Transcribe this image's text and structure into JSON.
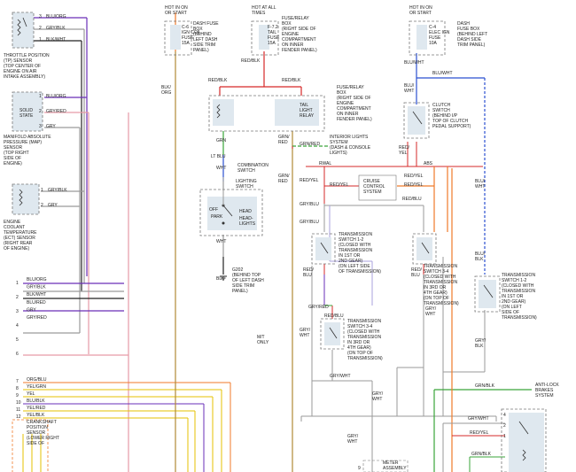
{
  "colors": {
    "purple": "#6a2fb8",
    "blue": "#2b4fd0",
    "black": "#222222",
    "pink": "#e79aa6",
    "gray": "#9a9a9a",
    "red": "#d62828",
    "orange": "#f07a2a",
    "yellow": "#e6c200",
    "green": "#3aa53a",
    "olive": "#b08a36",
    "lavender": "#a9a2dc",
    "tan": "#a88f6a",
    "box_fill": "#dfe8ef"
  },
  "left": {
    "tp_pins": [
      "3",
      "2",
      "1"
    ],
    "tp_wires": [
      "BLU/ORG",
      "GRY/BLK",
      "BLK/WHT"
    ],
    "tp_lines": [
      "THROTTLE POSITION",
      "(TP) SENSOR",
      "(TOP CENTER OF",
      "ENGINE ON AIR",
      "INTAKE ASSEMBLY)"
    ],
    "map_pins": [
      "1",
      "2",
      "3"
    ],
    "map_wires": [
      "BLU/ORG",
      "GRY/RED",
      "GRY"
    ],
    "map_box": [
      "SOLID",
      "STATE"
    ],
    "map_lines": [
      "MANIFOLD ABSOLUTE",
      "PRESSURE (MAP)",
      "SENSOR",
      "(TOP RIGHT",
      "SIDE OF",
      "ENGINE)"
    ],
    "ect_pins": [
      "1",
      "2"
    ],
    "ect_wires": [
      "GRY/BLK",
      "GRY"
    ],
    "ect_lines": [
      "ENGINE",
      "COOLANT",
      "TEMPERATURE",
      "(ECT) SENSOR",
      "(RIGHT REAR",
      "OF ENGINE)"
    ],
    "bus_labels": [
      "BLU/ORG",
      "GRY/BLK",
      "BLK/WHT",
      "BLU/RED",
      "GRY",
      "GRY/RED"
    ],
    "bus_nums": [
      "1",
      "2",
      "3",
      "4",
      "5",
      "6"
    ],
    "bus2_labels": [
      "ORG/BLU",
      "YEL/GRN",
      "YEL",
      "BLU/BLK",
      "YEL/RED",
      "YEL/BLK"
    ],
    "bus2_nums": [
      "7",
      "8",
      "9",
      "10",
      "11",
      "12"
    ],
    "ckp_lines": [
      "CRANKSHAFT",
      "POSITION",
      "SENSOR",
      "(LOWER RIGHT",
      "SIDE OF"
    ],
    "left_vertical": [
      "BLK/",
      "ORG"
    ]
  },
  "top": {
    "hot1": [
      "HOT IN ON",
      "OR START"
    ],
    "fuse_c6": [
      "C-6",
      "IGN COIL",
      "FUSE",
      "15A"
    ],
    "dash_fuse_box": [
      "DASH FUSE",
      "BOX",
      "(BEHIND",
      "LEFT DASH",
      "SIDE TRIM",
      "PANEL)"
    ],
    "hot2": [
      "HOT AT ALL",
      "TIMES"
    ],
    "fuse_f72": [
      "F-7.2",
      "TAIL",
      "FUSE",
      "15A"
    ],
    "relay_box1": [
      "FUSE/RELAY",
      "BOX",
      "(RIGHT SIDE OF",
      "ENGINE",
      "COMPARTMENT",
      "ON INNER",
      "FENDER PANEL)"
    ],
    "hot3": [
      "HOT IN ON",
      "OR START"
    ],
    "fuse_c4": [
      "C-4",
      "ELEC IGN",
      "FUSE",
      "10A"
    ],
    "dash_fuse_box2": [
      "DASH",
      "FUSE BOX",
      "(BEHIND LEFT",
      "DASH SIDE",
      "TRIM PANEL)"
    ]
  },
  "center": {
    "red_blk_1": "RED/BLK",
    "red_blk_2": "RED/BLK",
    "red_blk_3": "RED/BLK",
    "tail_relay": [
      "TAIL",
      "LIGHT",
      "RELAY"
    ],
    "relay_box2": [
      "FUSE/RELAY",
      "BOX",
      "(RIGHT SIDE OF",
      "ENGINE",
      "COMPARTMENT",
      "ON INNER",
      "FENDER PANEL)"
    ],
    "grn": "GRN",
    "lt_blu": "LT BLU",
    "wht": "WHT",
    "combo": [
      "COMBINATION",
      "SWITCH"
    ],
    "lighting": [
      "LIGHTING",
      "SWITCH"
    ],
    "off": "OFF",
    "park": "PARK",
    "head": "HEAD",
    "headlights": [
      "HEAD-",
      "LIGHTS"
    ],
    "wht2": "WHT",
    "blk": "BLK",
    "g202": [
      "G202",
      "(BEHIND TOP",
      "OF LEFT DASH",
      "SIDE TRIM",
      "PANEL)"
    ],
    "grn_red": [
      "GRN/",
      "RED"
    ],
    "grn_red2": "GRN/RED",
    "interior": [
      "INTERIOR LIGHTS",
      "SYSTEM",
      "(DASH & CONSOLE",
      "LIGHTS)"
    ],
    "grn_red3": [
      "GRN/",
      "RED"
    ],
    "mt_only": [
      "M/T",
      "ONLY"
    ]
  },
  "cruise": {
    "rwal": "RWAL",
    "abs": "ABS",
    "red_yel_l": "RED/YEL",
    "red_yel_c": "RED/YEL",
    "red_yel_r": "RED/YEL",
    "red_yel_r2": "RED/YEL",
    "cruise_box": [
      "CRUISE",
      "CONTROL",
      "SYSTEM"
    ],
    "gry_blu": "GRY/BLU",
    "gry_blu2": "GRY/BLU",
    "red_blu": "RED/BLU",
    "ts12a": [
      "TRANSMISSION",
      "SWITCH 1-2",
      "(CLOSED WITH",
      "TRANSMISSION",
      "IN 1ST OR",
      "2ND GEAR)",
      "(ON LEFT SIDE",
      "OF TRANSMISSION)"
    ],
    "red_blu_b": [
      "RED/",
      "BLU"
    ],
    "gry_red": "GRY/RED",
    "ts34a": [
      "TRANSMISSION",
      "SWITCH 3-4",
      "(CLOSED WITH",
      "TRANSMISSION",
      "IN 3RD OR",
      "4TH GEAR)",
      "(ON TOP OF",
      "TRANSMISSION)"
    ],
    "red_blu_c": "RED/BLU",
    "gry_wht_a": [
      "GRY/",
      "WHT"
    ],
    "gry_wht_b": "GRY/WHT",
    "gry_wht_c": [
      "GRY/",
      "WHT"
    ],
    "red_blu_r": [
      "RED/",
      "BLU"
    ],
    "ts34b": [
      "TRANSMISSION",
      "SWITCH 3-4",
      "(CLOSED WITH",
      "TRANSMISSION",
      "IN 3RD OR",
      "4TH GEAR)",
      "(ON TOP OF",
      "TRANSMISSION)"
    ],
    "gry_wht_r": [
      "GRY/",
      "WHT"
    ],
    "gry_wht_bottom": [
      "GRY/",
      "WHT"
    ],
    "meter": [
      "METER",
      "ASSEMBLY"
    ],
    "num9": "9"
  },
  "right": {
    "blu_wht": "BLU/WHT",
    "blu_wht_2": "BLU/WHT",
    "blu_wht_3": [
      "BLU/",
      "WHT"
    ],
    "clutch": [
      "CLUTCH",
      "SWITCH",
      "(BEHIND I/P",
      "TOP OF CLUTCH",
      "PEDAL SUPPORT)"
    ],
    "red_yel": [
      "RED/",
      "YEL"
    ],
    "blu_wht_4": [
      "BLU/",
      "WHT"
    ],
    "ts12b": [
      "TRANSMISSION",
      "SWITCH 1-2",
      "(CLOSED WITH",
      "TRANSMISSION",
      "IN 1ST OR",
      "2ND GEAR)",
      "(ON LEFT",
      "SIDE OF",
      "TRANSMISSION)"
    ],
    "blu_blk": [
      "BLU/",
      "BLK"
    ],
    "gry_blk": [
      "GRY/",
      "BLK"
    ],
    "grn_blk": "GRN/BLK",
    "abs_sys": [
      "ANTI-LOCK",
      "BRAKES",
      "SYSTEM"
    ],
    "gry_wht_r": "GRY/WHT",
    "red_yel_r": "RED/YEL",
    "grn_blk_r": "GRN/BLK",
    "pins": [
      "4",
      "2",
      "1"
    ]
  }
}
